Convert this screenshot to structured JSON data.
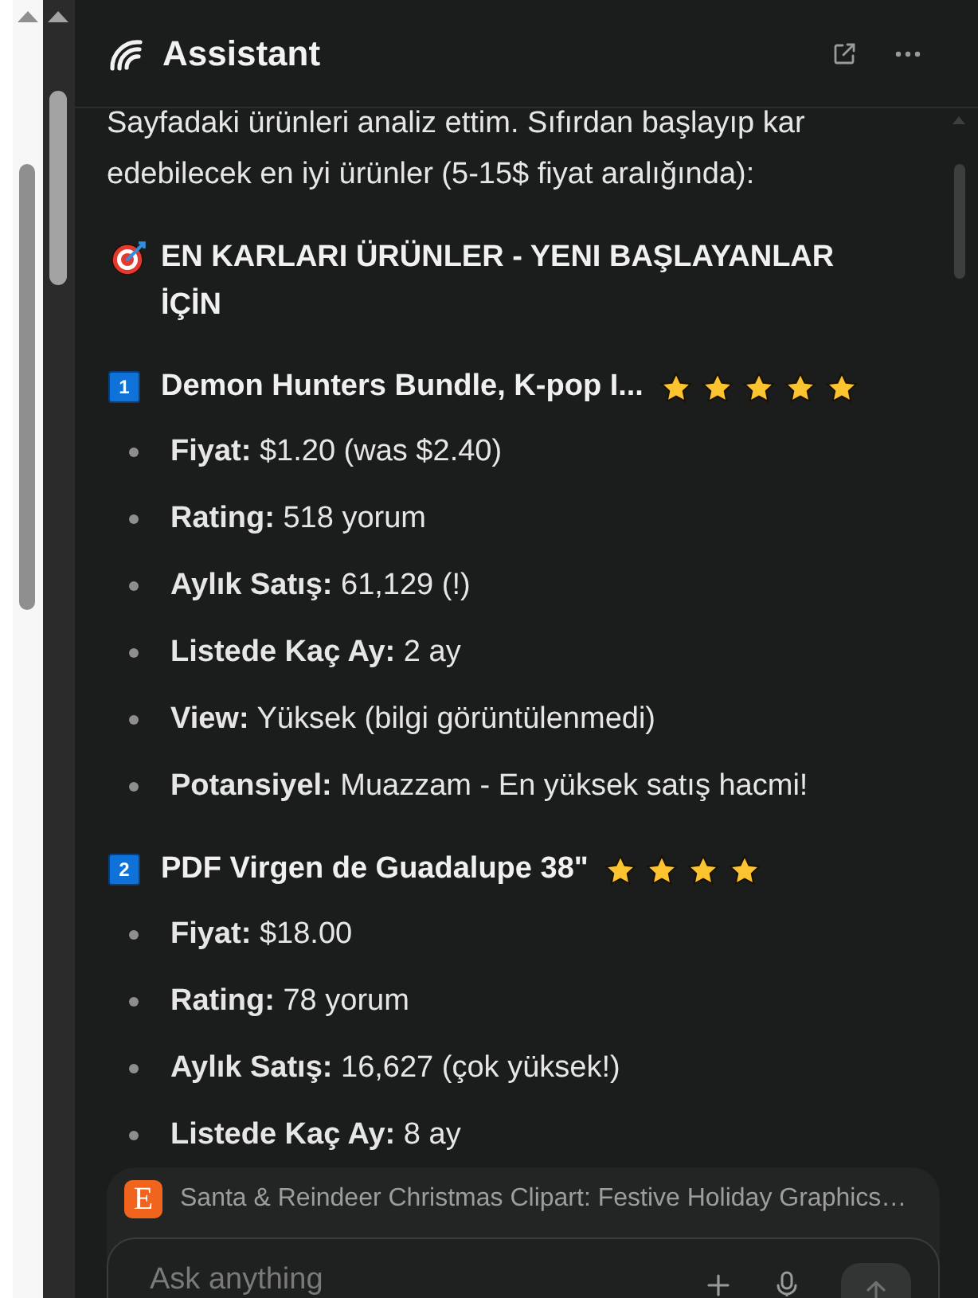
{
  "header": {
    "title": "Assistant"
  },
  "message": {
    "intro": "Sayfadaki ürünleri analiz ettim. Sıfırdan başlayıp kar edebilecek en iyi ürünler (5-15$ fiyat aralığında):",
    "heading": "EN KARLARI ÜRÜNLER - YENI BAŞLAYANLAR İÇİN",
    "products": [
      {
        "number": "1",
        "title": "Demon Hunters Bundle, K-pop I...",
        "stars": 5,
        "details": [
          "**Fiyat:** $1.20 (was $2.40)",
          "**Rating:** 518 yorum",
          "**Aylık Satış:** 61,129 (!)",
          "**Listede Kaç Ay:** 2 ay",
          "**View:** Yüksek (bilgi görüntülenmedi)",
          "**Potansiyel:** Muazzam - En yüksek satış hacmi!"
        ]
      },
      {
        "number": "2",
        "title": "PDF Virgen de Guadalupe 38\"",
        "stars": 4,
        "details": [
          "**Fiyat:** $18.00",
          "**Rating:** 78 yorum",
          "**Aylık Satış:** 16,627 (çok yüksek!)",
          "**Listede Kaç Ay:** 8 ay"
        ]
      }
    ]
  },
  "context_page": {
    "logo_letter": "E",
    "title": "Santa & Reindeer Christmas Clipart: Festive Holiday Graphics…"
  },
  "composer": {
    "placeholder": "Ask anything"
  }
}
